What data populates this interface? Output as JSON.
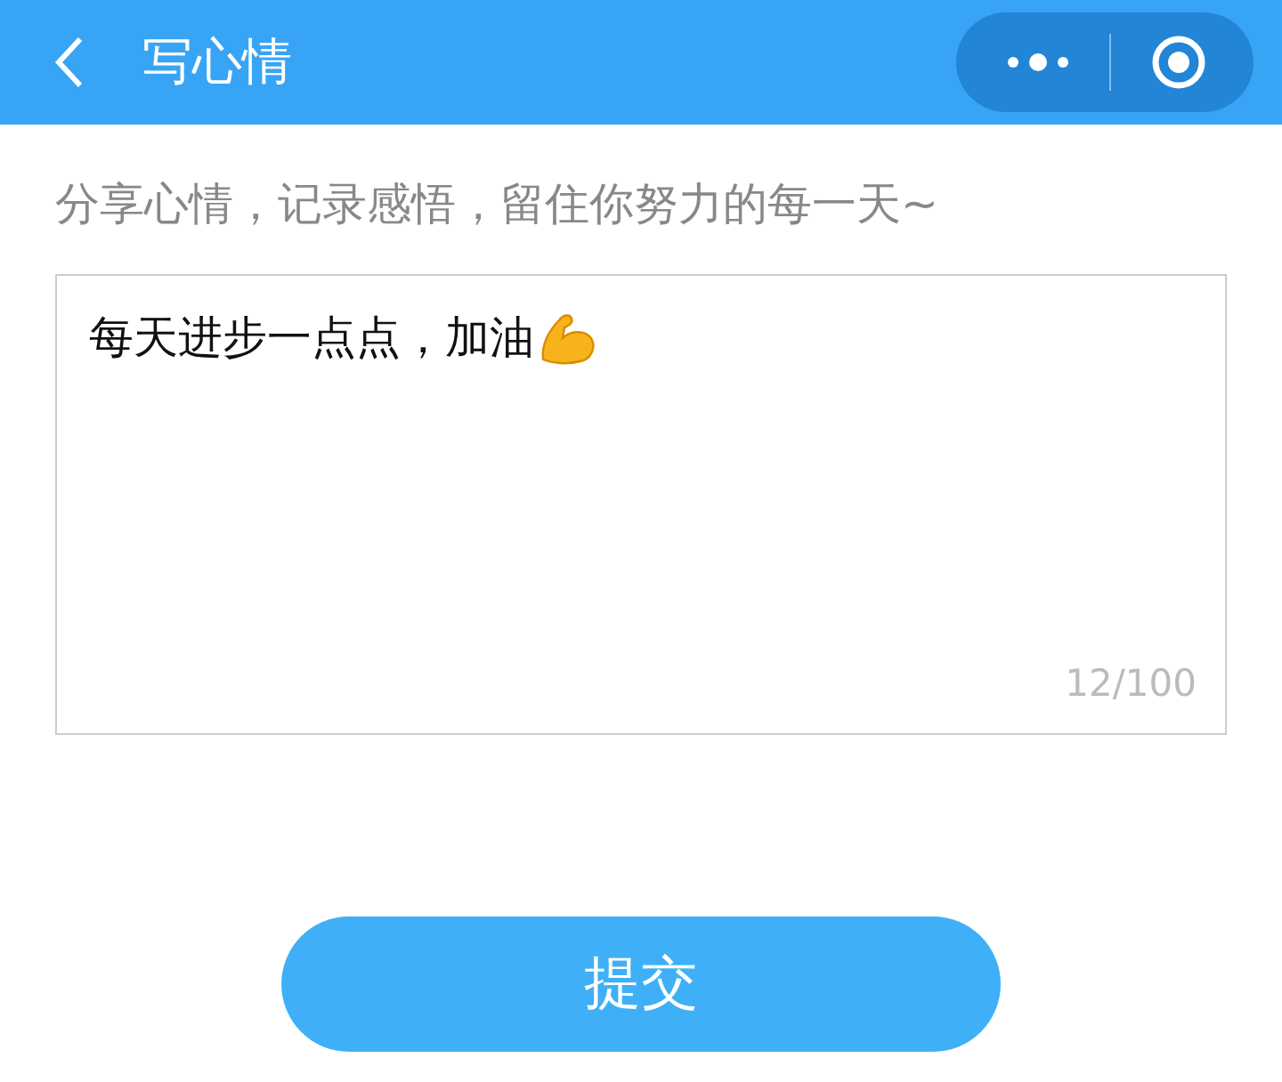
{
  "nav_bar": {
    "title": "写心情"
  },
  "prompt": "分享心情，记录感悟，留住你努力的每一天~",
  "text_area": {
    "value": "每天进步一点点，加油",
    "counter": "12/100"
  },
  "submit_button": "提交"
}
